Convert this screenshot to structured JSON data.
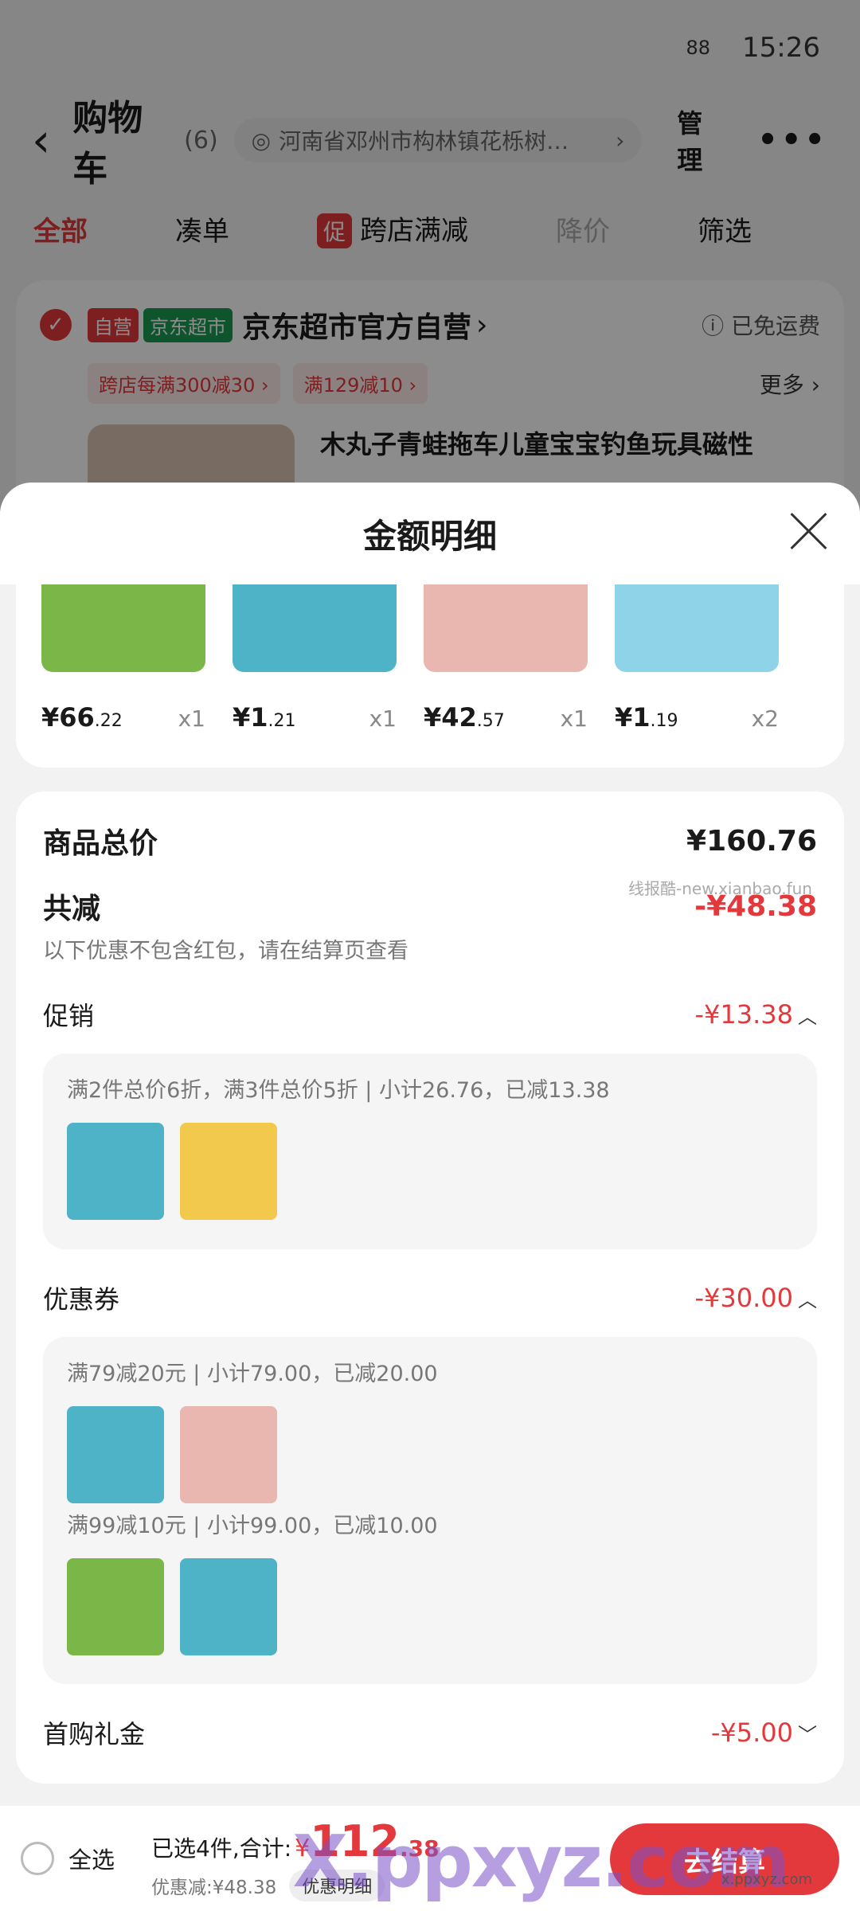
{
  "status": {
    "signal": "88",
    "time": "15:26"
  },
  "nav": {
    "back": "‹",
    "title": "购物车",
    "count": "(6)",
    "address": "河南省邓州市构林镇花栎树…",
    "address_chevron": "›",
    "manage": "管理",
    "more": "•••"
  },
  "tabs": [
    {
      "label": "全部",
      "state": "active"
    },
    {
      "label": "凑单",
      "state": "normal"
    },
    {
      "badge": "促",
      "label": "跨店满减",
      "state": "normal"
    },
    {
      "label": "降价",
      "state": "dim"
    },
    {
      "label": "筛选",
      "state": "normal"
    }
  ],
  "store": {
    "tag_self": "自营",
    "tag_super": "京东超市",
    "name": "京东超市官方自营",
    "chevron": "›",
    "shipping": "已免运费",
    "promos": [
      "跨店每满300减30 ›",
      "满129减10 ›"
    ],
    "more": "更多 ›",
    "product_title": "木丸子青蛙拖车儿童宝宝钓鱼玩具磁性"
  },
  "sheet": {
    "title": "金额明细",
    "items": [
      {
        "price_int": "¥66",
        "price_dec": ".22",
        "qty": "x1",
        "color": "#7ab648"
      },
      {
        "price_int": "¥1",
        "price_dec": ".21",
        "qty": "x1",
        "color": "#4fb3c8"
      },
      {
        "price_int": "¥42",
        "price_dec": ".57",
        "qty": "x1",
        "color": "#e9b7b0"
      },
      {
        "price_int": "¥1",
        "price_dec": ".19",
        "qty": "x2",
        "color": "#8fd3e8"
      }
    ],
    "total_label": "商品总价",
    "total_value": "¥160.76",
    "watermark": "线报酷-new.xianbao.fun",
    "discount_label": "共减",
    "discount_value": "-¥48.38",
    "discount_note": "以下优惠不包含红包，请在结算页查看",
    "promo": {
      "label": "促销",
      "value": "-¥13.38",
      "caret": "︿",
      "detail": "满2件总价6折，满3件总价5折 | 小计26.76，已减13.38",
      "thumbs": [
        "#4fb3c8",
        "#f2c94c"
      ]
    },
    "coupon": {
      "label": "优惠券",
      "value": "-¥30.00",
      "caret": "︿",
      "groups": [
        {
          "detail": "满79减20元 | 小计79.00，已减20.00",
          "thumbs": [
            "#4fb3c8",
            "#e9b7b0"
          ]
        },
        {
          "detail": "满99减10元 | 小计99.00，已减10.00",
          "thumbs": [
            "#7ab648",
            "#4fb3c8"
          ]
        }
      ]
    },
    "gift": {
      "label": "首购礼金",
      "value": "-¥5.00",
      "caret": "﹀"
    }
  },
  "bottom": {
    "select_all": "全选",
    "selected_prefix": "已选4件,合计:",
    "currency": "¥",
    "total_int": "112",
    "total_dec": ".38",
    "saved": "优惠减:¥48.38",
    "detail_btn": "优惠明细",
    "checkout": "去结算",
    "watermark": "X.ppxyz.com",
    "watermark_sub": "x.ppxyz.com"
  },
  "colors": {
    "accent": "#e4393c",
    "supermarket": "#1a9a53"
  }
}
